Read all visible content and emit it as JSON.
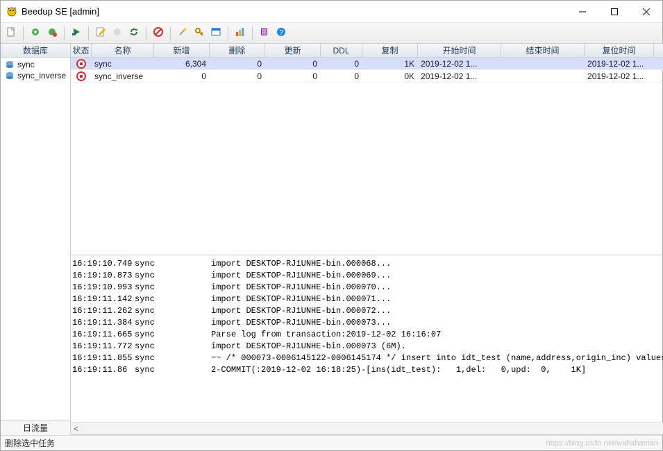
{
  "window": {
    "title": "Beedup SE [admin]"
  },
  "toolbar_names": [
    "new-doc",
    "sep",
    "gear-green",
    "gear-red",
    "sep",
    "play-green",
    "sep",
    "edit-pencil",
    "circle-grey",
    "sync-green",
    "sep",
    "no-entry",
    "sep",
    "wand",
    "key",
    "window",
    "sep",
    "chart-bars",
    "sep",
    "help-book",
    "help-question"
  ],
  "left": {
    "header": "数据库",
    "items": [
      "sync",
      "sync_inverse"
    ],
    "footer": "日流量"
  },
  "grid": {
    "columns": [
      "状态",
      "名称",
      "新增",
      "删除",
      "更新",
      "DDL",
      "复制",
      "开始时间",
      "结束时间",
      "复位时间"
    ],
    "rows": [
      {
        "name": "sync",
        "new": "6,304",
        "del": "0",
        "upd": "0",
        "ddl": "0",
        "copy": "1K",
        "start": "2019-12-02 1...",
        "end": "",
        "reset": "2019-12-02 1...",
        "selected": true
      },
      {
        "name": "sync_inverse",
        "new": "0",
        "del": "0",
        "upd": "0",
        "ddl": "0",
        "copy": "0K",
        "start": "2019-12-02 1...",
        "end": "",
        "reset": "2019-12-02 1...",
        "selected": false
      }
    ]
  },
  "log": [
    {
      "ts": "16:19:10.749",
      "src": "sync",
      "msg": "import DESKTOP-RJ1UNHE-bin.000068..."
    },
    {
      "ts": "16:19:10.873",
      "src": "sync",
      "msg": "import DESKTOP-RJ1UNHE-bin.000069..."
    },
    {
      "ts": "16:19:10.993",
      "src": "sync",
      "msg": "import DESKTOP-RJ1UNHE-bin.000070..."
    },
    {
      "ts": "16:19:11.142",
      "src": "sync",
      "msg": "import DESKTOP-RJ1UNHE-bin.000071..."
    },
    {
      "ts": "16:19:11.262",
      "src": "sync",
      "msg": "import DESKTOP-RJ1UNHE-bin.000072..."
    },
    {
      "ts": "16:19:11.384",
      "src": "sync",
      "msg": "import DESKTOP-RJ1UNHE-bin.000073..."
    },
    {
      "ts": "16:19:11.665",
      "src": "sync",
      "msg": "Parse log from transaction:2019-12-02 16:16:07"
    },
    {
      "ts": "16:19:11.772",
      "src": "sync",
      "msg": "import DESKTOP-RJ1UNHE-bin.000073 (6M)."
    },
    {
      "ts": "16:19:11.855",
      "src": "sync",
      "msg": "~~ /* 000073-0006145122-0006145174 */ insert into idt_test (name,address,origin_inc) values("
    },
    {
      "ts": "16:19:11.86",
      "src": "sync",
      "msg": "2-COMMIT(:2019-12-02 16:18:25)-[ins(idt_test):   1,del:   0,upd:  0,    1K]"
    }
  ],
  "statusbar": {
    "text": "删除选中任务",
    "watermark": "https://blog.csdn.net/wahahaman"
  }
}
